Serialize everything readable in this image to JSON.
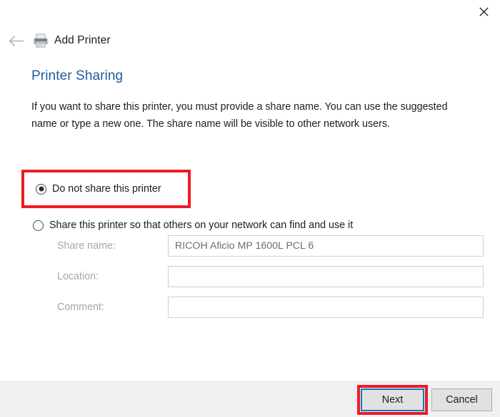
{
  "window": {
    "close_label": "✕",
    "close_icon": "close-icon"
  },
  "header": {
    "back_icon": "back-arrow-icon",
    "printer_icon": "printer-icon",
    "title": "Add Printer"
  },
  "main": {
    "heading": "Printer Sharing",
    "intro": "If you want to share this printer, you must provide a share name. You can use the suggested name or type a new one. The share name will be visible to other network users.",
    "radios": [
      {
        "label": "Do not share this printer",
        "checked": true,
        "highlighted": true
      },
      {
        "label": "Share this printer so that others on your network can find and use it",
        "checked": false,
        "highlighted": false
      }
    ],
    "fields": [
      {
        "label": "Share name:",
        "value": "RICOH Aficio MP 1600L PCL 6",
        "disabled": true
      },
      {
        "label": "Location:",
        "value": "",
        "disabled": true
      },
      {
        "label": "Comment:",
        "value": "",
        "disabled": true
      }
    ]
  },
  "footer": {
    "next_label": "Next",
    "cancel_label": "Cancel"
  },
  "colors": {
    "heading_blue": "#205d9e",
    "highlight_red": "#ec1c24",
    "focus_blue": "#1774c4",
    "footer_bg": "#f0f0f0",
    "disabled_text": "#a6a6a6"
  }
}
